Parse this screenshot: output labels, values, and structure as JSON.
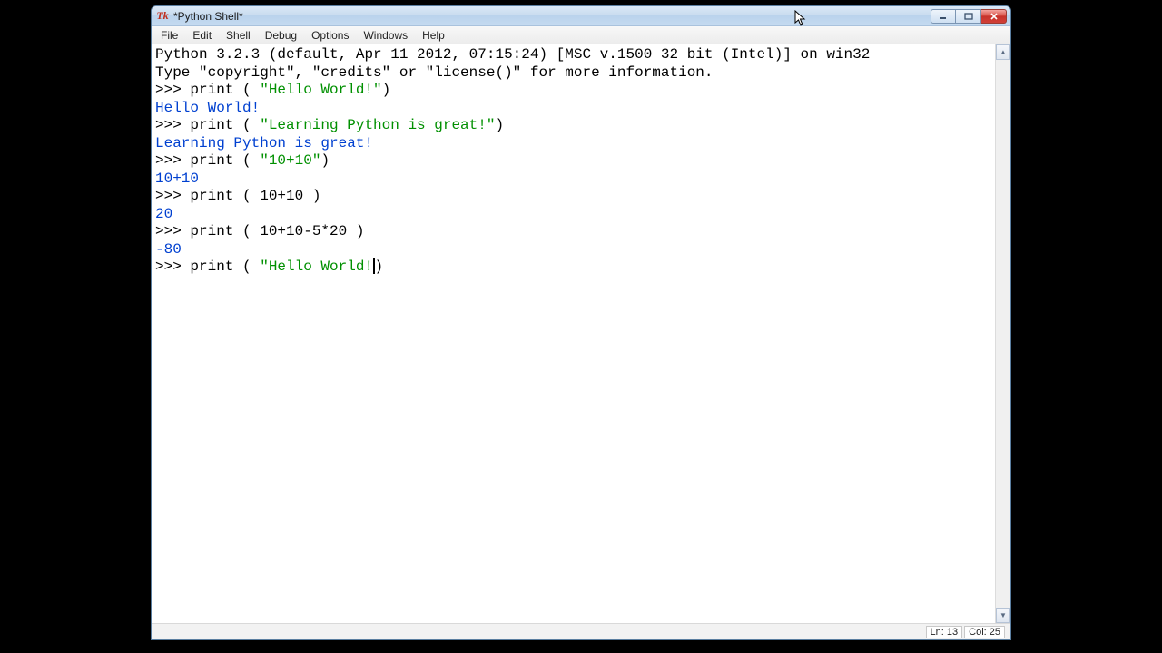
{
  "window": {
    "title": "*Python Shell*",
    "icon_label": "Tk"
  },
  "menus": [
    "File",
    "Edit",
    "Shell",
    "Debug",
    "Options",
    "Windows",
    "Help"
  ],
  "shell": {
    "banner1": "Python 3.2.3 (default, Apr 11 2012, 07:15:24) [MSC v.1500 32 bit (Intel)] on win32",
    "banner2": "Type \"copyright\", \"credits\" or \"license()\" for more information.",
    "lines": [
      {
        "type": "in",
        "prefix": ">>> ",
        "call": "print ( ",
        "str": "\"Hello World!\"",
        "tail": ")"
      },
      {
        "type": "out_str",
        "text": "Hello World!"
      },
      {
        "type": "in",
        "prefix": ">>> ",
        "call": "print ( ",
        "str": "\"Learning Python is great!\"",
        "tail": ")"
      },
      {
        "type": "out_str",
        "text": "Learning Python is great!"
      },
      {
        "type": "in",
        "prefix": ">>> ",
        "call": "print ( ",
        "str": "\"10+10\"",
        "tail": ")"
      },
      {
        "type": "out_num",
        "text": "10+10"
      },
      {
        "type": "in",
        "prefix": ">>> ",
        "call": "print ( ",
        "plain": "10+10 ",
        "tail": ")"
      },
      {
        "type": "out_num",
        "text": "20"
      },
      {
        "type": "in",
        "prefix": ">>> ",
        "call": "print ( ",
        "plain": "10+10-5*20 ",
        "tail": ")"
      },
      {
        "type": "out_num",
        "text": "-80"
      },
      {
        "type": "in_current",
        "prefix": ">>> ",
        "call": "print ( ",
        "str": "\"Hello World!",
        "tail": ")"
      }
    ]
  },
  "status": {
    "line": "Ln: 13",
    "col": "Col: 25"
  }
}
